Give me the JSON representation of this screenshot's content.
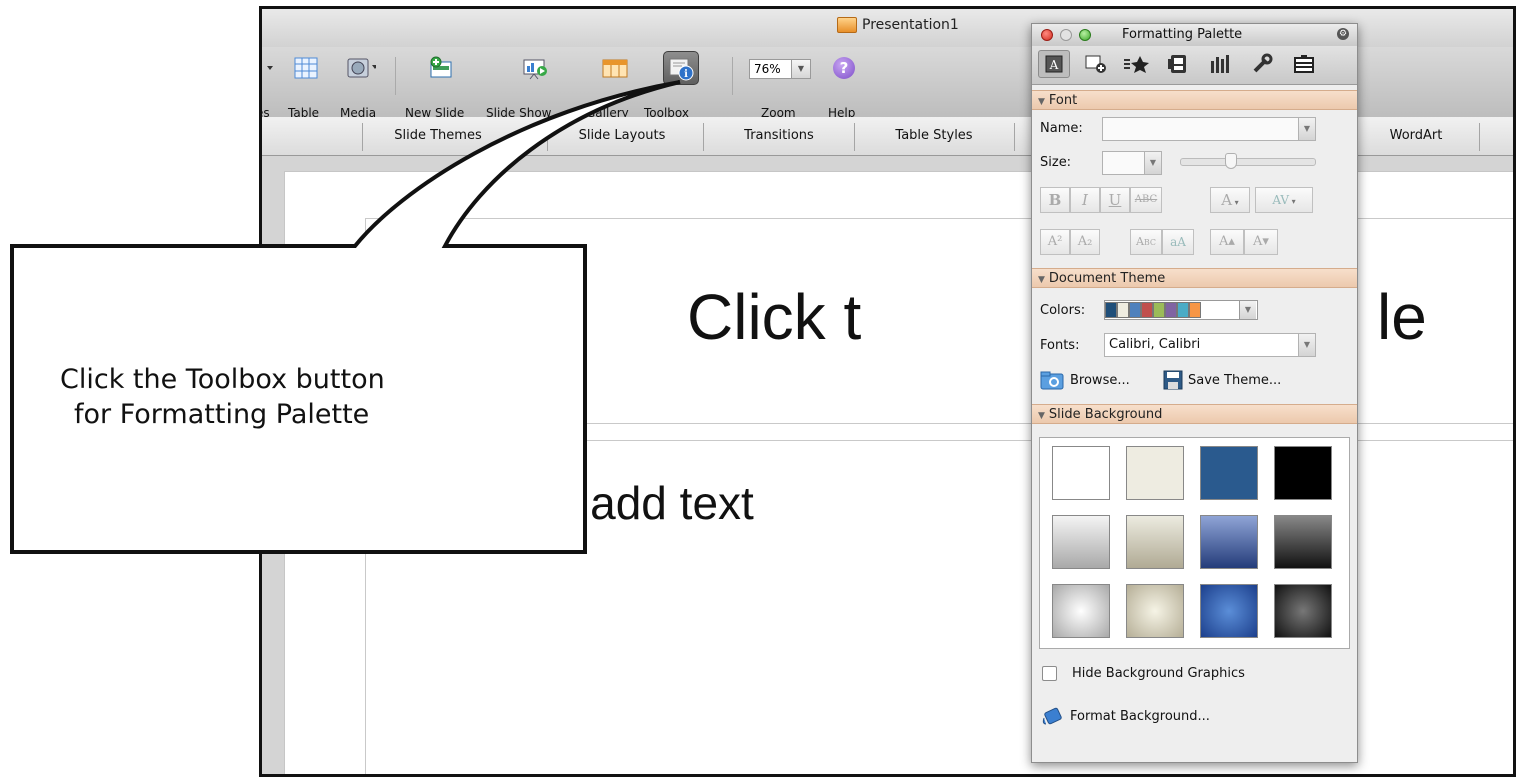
{
  "window": {
    "title": "Presentation1"
  },
  "toolbar": {
    "items": [
      {
        "label": "es",
        "icon": "dropdown-arrow-icon"
      },
      {
        "label": "Table",
        "icon": "table-grid-icon"
      },
      {
        "label": "Media",
        "icon": "media-icon"
      },
      {
        "label": "New Slide",
        "icon": "new-slide-icon"
      },
      {
        "label": "Slide Show",
        "icon": "slide-show-icon"
      },
      {
        "label": "Gallery",
        "icon": "gallery-icon"
      },
      {
        "label": "Toolbox",
        "icon": "toolbox-icon"
      },
      {
        "label": "Zoom",
        "icon": "zoom-select",
        "value": "76%"
      },
      {
        "label": "Help",
        "icon": "help-icon",
        "glyph": "?"
      }
    ]
  },
  "ribbon": {
    "tabs": [
      "Slide Themes",
      "Slide Layouts",
      "Transitions",
      "Table Styles",
      "WordArt"
    ]
  },
  "slide": {
    "title_placeholder": "Click to add title",
    "body_placeholder": "Click to add text",
    "visible_title_left": "Click t",
    "visible_title_right": "le",
    "visible_body": "to add text"
  },
  "callout": {
    "line1": "Click the Toolbox button",
    "line2": "for Formatting Palette"
  },
  "palette": {
    "title": "Formatting Palette",
    "tabs": [
      "text-format-icon",
      "insert-object-icon",
      "bullets-star-icon",
      "picture-icon",
      "chart-bars-icon",
      "wrench-icon",
      "inbox-icon"
    ],
    "font": {
      "header": "Font",
      "name_label": "Name:",
      "name_value": "",
      "size_label": "Size:",
      "size_value": "",
      "bold": "B",
      "italic": "I",
      "underline": "U",
      "strike": "ABC",
      "font_color": "A",
      "char_spacing": "AV",
      "superscript": "A²",
      "subscript": "A₂",
      "small_caps": "Abc",
      "change_case": "aA",
      "grow": "A▴",
      "shrink": "A▾"
    },
    "theme": {
      "header": "Document Theme",
      "colors_label": "Colors:",
      "colors": [
        "#1f4e79",
        "#eeece1",
        "#4f81bd",
        "#c0504d",
        "#9bbb59",
        "#8064a2",
        "#4bacc6",
        "#f79646"
      ],
      "fonts_label": "Fonts:",
      "fonts_value": "Calibri, Calibri",
      "browse": "Browse...",
      "save": "Save Theme..."
    },
    "background": {
      "header": "Slide Background",
      "cells": [
        [
          "#ffffff",
          "#eeece1",
          "#1f4e79",
          "#000000"
        ],
        [
          "gradient-gray",
          "gradient-tan",
          "gradient-blue",
          "gradient-dark"
        ],
        [
          "radial-gray",
          "radial-tan",
          "radial-blue",
          "radial-dark"
        ]
      ],
      "hide_graphics": "Hide Background Graphics",
      "format": "Format Background..."
    }
  }
}
